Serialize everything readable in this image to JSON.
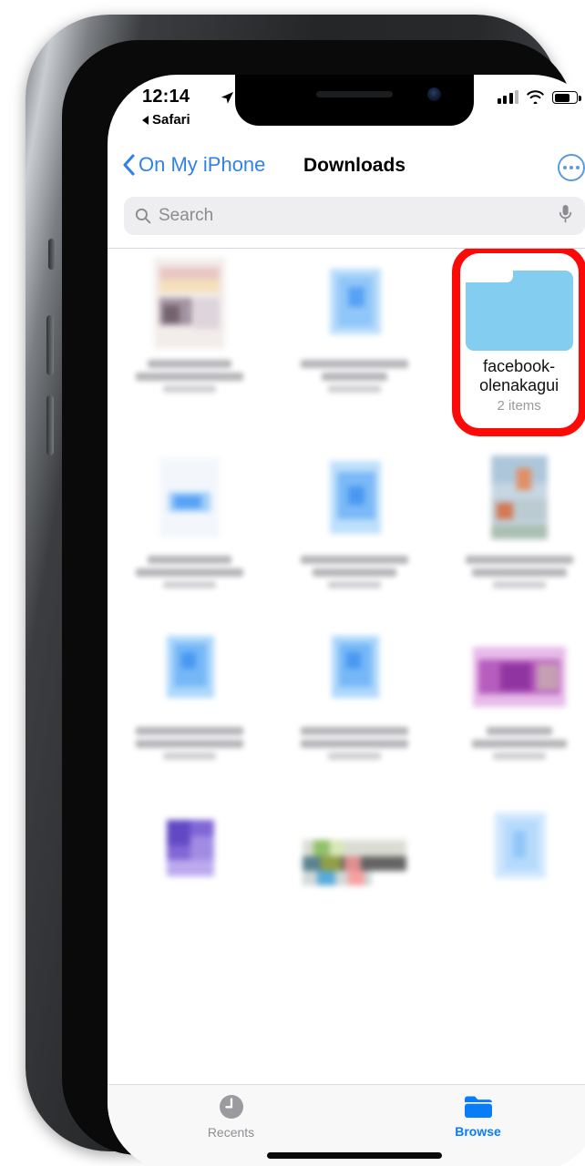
{
  "status_bar": {
    "time": "12:14",
    "location_icon": "location-arrow-icon",
    "signal_icon": "cellular-signal-icon",
    "wifi_icon": "wifi-icon",
    "battery_icon": "battery-icon",
    "battery_level_percent": 62
  },
  "back_to_app": {
    "label": "Safari",
    "icon": "back-triangle-icon"
  },
  "nav_bar": {
    "back_label": "On My iPhone",
    "back_icon": "chevron-left-icon",
    "title": "Downloads",
    "more_icon": "ellipsis-circle-icon"
  },
  "search": {
    "placeholder": "Search",
    "search_icon": "magnifier-icon",
    "mic_icon": "microphone-icon"
  },
  "highlight": {
    "color": "#fb0a08"
  },
  "folder": {
    "icon": "folder-icon",
    "icon_color": "#82cdf0",
    "name": "facebook-olenakagui",
    "subtitle": "2 items"
  },
  "grid": {
    "rows": [
      {
        "cells": [
          {
            "type": "blurred-thumbnail",
            "accent": "#d9c3c0"
          },
          {
            "type": "blurred-thumbnail",
            "accent": "#59a8f5"
          },
          {
            "type": "folder"
          }
        ]
      },
      {
        "cells": [
          {
            "type": "blurred-thumbnail",
            "accent": "#4f9ef5"
          },
          {
            "type": "blurred-thumbnail",
            "accent": "#4f9ef5"
          },
          {
            "type": "blurred-thumbnail",
            "accent": "#9ab4cc"
          }
        ]
      },
      {
        "cells": [
          {
            "type": "blurred-thumbnail",
            "accent": "#4f9ef5"
          },
          {
            "type": "blurred-thumbnail",
            "accent": "#4f9ef5"
          },
          {
            "type": "blurred-thumbnail",
            "accent": "#a93fbb"
          }
        ]
      },
      {
        "cells": [
          {
            "type": "blurred-thumbnail",
            "accent": "#6b4fc9"
          },
          {
            "type": "blurred-thumbnail",
            "accent": "#8fae6e"
          },
          {
            "type": "blurred-thumbnail",
            "accent": "#9fd0fa"
          }
        ]
      }
    ]
  },
  "tab_bar": {
    "tabs": [
      {
        "label": "Recents",
        "icon": "clock-icon",
        "active": false
      },
      {
        "label": "Browse",
        "icon": "folder-icon",
        "active": true
      }
    ],
    "active_color": "#0a7cf5",
    "inactive_color": "#8e8e93"
  }
}
